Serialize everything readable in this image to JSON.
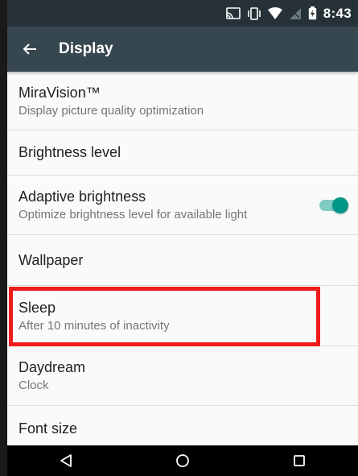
{
  "status_bar": {
    "time": "8:43",
    "icons": [
      "cast-icon",
      "vibrate-icon",
      "wifi-icon",
      "signal-icon",
      "battery-icon"
    ]
  },
  "toolbar": {
    "back_icon": "arrow-back-icon",
    "title": "Display"
  },
  "settings": {
    "miravision": {
      "title": "MiraVision™",
      "summary": "Display picture quality optimization"
    },
    "brightness_level": {
      "title": "Brightness level"
    },
    "adaptive_brightness": {
      "title": "Adaptive brightness",
      "summary": "Optimize brightness level for available light",
      "enabled": true
    },
    "wallpaper": {
      "title": "Wallpaper"
    },
    "sleep": {
      "title": "Sleep",
      "summary": "After 10 minutes of inactivity"
    },
    "daydream": {
      "title": "Daydream",
      "summary": "Clock"
    },
    "font_size": {
      "title": "Font size"
    }
  },
  "nav_bar": {
    "buttons": [
      "back-triangle-icon",
      "home-circle-icon",
      "recents-square-icon"
    ]
  },
  "colors": {
    "status_bar": "#263238",
    "toolbar": "#37474f",
    "accent": "#009688",
    "highlight": "#ee1c1c"
  }
}
